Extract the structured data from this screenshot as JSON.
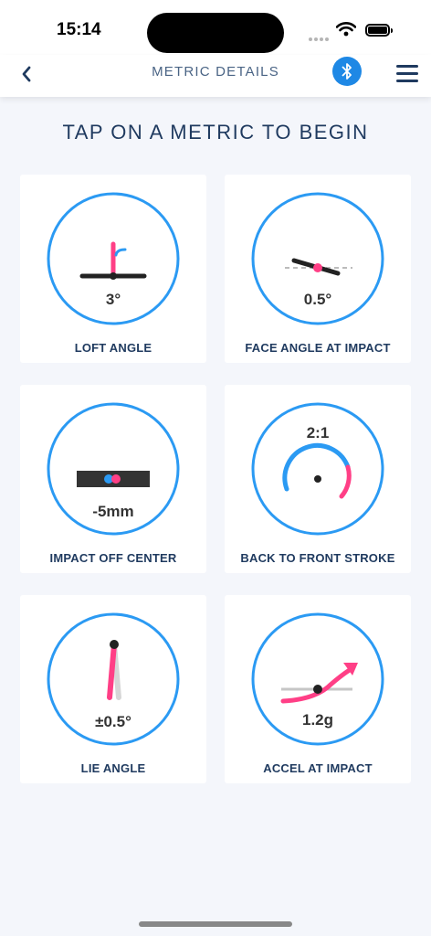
{
  "status_bar": {
    "time": "15:14"
  },
  "nav": {
    "back_icon": "chevron-left-icon",
    "title": "METRIC DETAILS",
    "bluetooth_icon": "bluetooth-icon",
    "menu_icon": "hamburger-menu-icon"
  },
  "heading": "TAP ON A METRIC TO BEGIN",
  "colors": {
    "accent_blue": "#2b9af3",
    "accent_pink": "#ff3f86",
    "navy": "#1f3a5f"
  },
  "metrics": [
    {
      "label": "LOFT ANGLE",
      "value": "3°"
    },
    {
      "label": "FACE ANGLE AT IMPACT",
      "value": "0.5°"
    },
    {
      "label": "IMPACT OFF CENTER",
      "value": "-5mm"
    },
    {
      "label": "BACK TO FRONT STROKE",
      "value": "2:1"
    },
    {
      "label": "LIE ANGLE",
      "value": "±0.5°"
    },
    {
      "label": "ACCEL AT IMPACT",
      "value": "1.2g"
    }
  ]
}
